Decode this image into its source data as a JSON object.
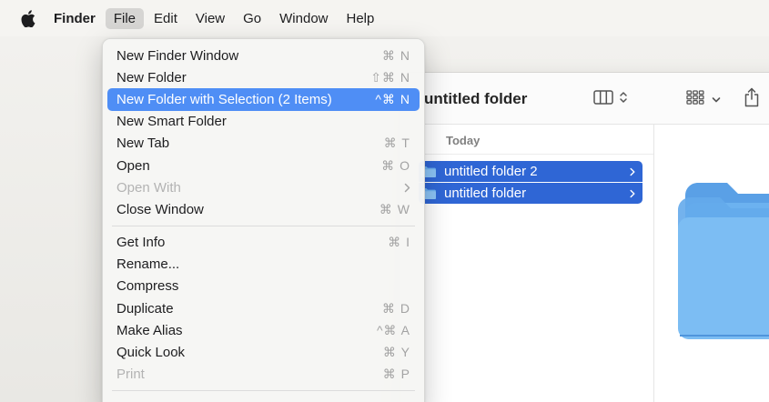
{
  "menubar": {
    "app_name": "Finder",
    "menus": [
      "File",
      "Edit",
      "View",
      "Go",
      "Window",
      "Help"
    ],
    "active_menu": "File"
  },
  "finder_window": {
    "title": "untitled folder",
    "section_header": "Today",
    "files": [
      {
        "name": "untitled folder 2",
        "selected": true
      },
      {
        "name": "untitled folder",
        "selected": true
      }
    ],
    "folder_color": "#5aa6ec",
    "selection_color": "#2f66d5"
  },
  "file_menu": {
    "items": [
      {
        "label": "New Finder Window",
        "shortcut": "⌘ N"
      },
      {
        "label": "New Folder",
        "shortcut": "⇧⌘ N"
      },
      {
        "label": "New Folder with Selection (2 Items)",
        "shortcut": "^⌘ N",
        "highlighted": true
      },
      {
        "label": "New Smart Folder",
        "shortcut": ""
      },
      {
        "label": "New Tab",
        "shortcut": "⌘ T"
      },
      {
        "label": "Open",
        "shortcut": "⌘ O"
      },
      {
        "label": "Open With",
        "shortcut": "",
        "disabled": true,
        "submenu": true
      },
      {
        "label": "Close Window",
        "shortcut": "⌘ W"
      },
      {
        "label": "Get Info",
        "shortcut": "⌘ I"
      },
      {
        "label": "Rename...",
        "shortcut": ""
      },
      {
        "label": "Compress",
        "shortcut": ""
      },
      {
        "label": "Duplicate",
        "shortcut": "⌘ D"
      },
      {
        "label": "Make Alias",
        "shortcut": "^⌘ A"
      },
      {
        "label": "Quick Look",
        "shortcut": "⌘ Y"
      },
      {
        "label": "Print",
        "shortcut": "⌘ P",
        "disabled": true
      }
    ],
    "highlight_color": "#4f8ef5"
  }
}
